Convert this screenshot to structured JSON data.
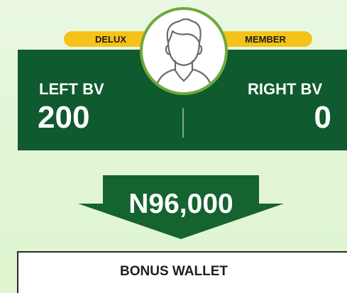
{
  "membership": {
    "badge_left": "DELUX",
    "badge_right": "MEMBER"
  },
  "bv": {
    "left_label": "LEFT BV",
    "left_value": "200",
    "right_label": "RIGHT BV",
    "right_value": "0"
  },
  "amount": {
    "value": "N96,000"
  },
  "wallet": {
    "title": "BONUS WALLET"
  },
  "icons": {
    "avatar": "user-avatar-icon"
  },
  "colors": {
    "panel_green": "#0f5a2f",
    "badge_yellow": "#f6c21a",
    "avatar_ring": "#6fa83a"
  }
}
